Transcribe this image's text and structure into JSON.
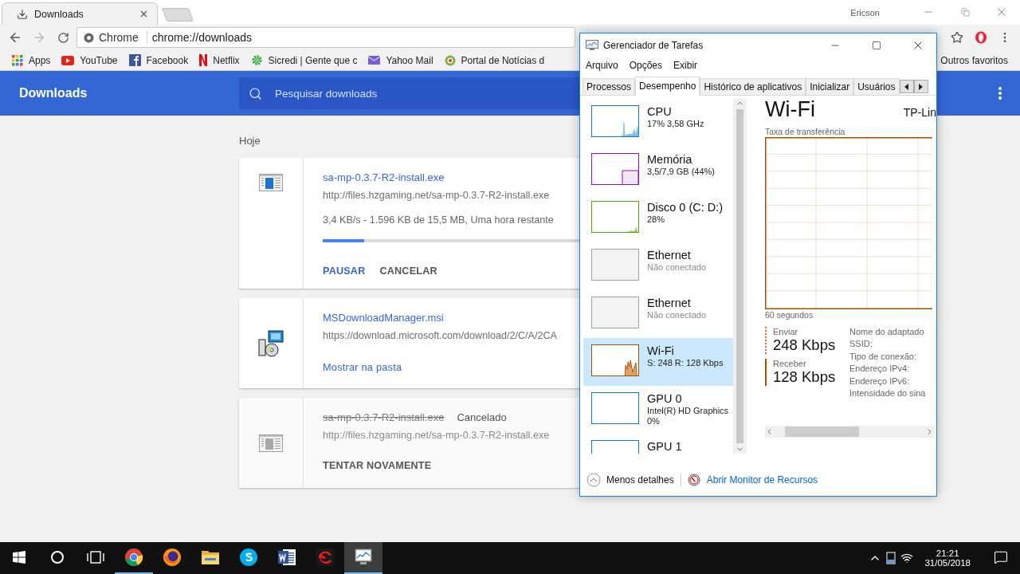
{
  "chrome": {
    "tab": {
      "title": "Downloads"
    },
    "user": "Ericson",
    "omnibox": {
      "chip": "Chrome",
      "url": "chrome://downloads"
    },
    "bookmarks": [
      {
        "kind": "apps",
        "label": "Apps"
      },
      {
        "kind": "youtube",
        "label": "YouTube"
      },
      {
        "kind": "facebook",
        "label": "Facebook"
      },
      {
        "kind": "netflix",
        "label": "Netflix"
      },
      {
        "kind": "sicredi",
        "label": "Sicredi | Gente que c"
      },
      {
        "kind": "mail",
        "label": "Yahoo Mail"
      },
      {
        "kind": "portal",
        "label": "Portal de Notícias d"
      }
    ],
    "other_bookmarks": "Outros favoritos"
  },
  "downloads_page": {
    "title": "Downloads",
    "search": {
      "placeholder": "Pesquisar downloads"
    },
    "section": "Hoje",
    "items": [
      {
        "kind": "in_progress",
        "name": "sa-mp-0.3.7-R2-install.exe",
        "url": "http://files.hzgaming.net/sa-mp-0.3.7-R2-install.exe",
        "status": "3,4 KB/s - 1.596 KB de 15,5 MB, Uma hora restante",
        "level": 0.16,
        "actions": [
          {
            "label": "PAUSAR",
            "primary": true
          },
          {
            "label": "CANCELAR",
            "primary": false
          }
        ]
      },
      {
        "kind": "complete",
        "name": "MSDownloadManager.msi",
        "url": "https://download.microsoft.com/download/2/C/A/2CA",
        "actions": [
          {
            "label": "Mostrar na pasta",
            "primary": true
          }
        ]
      },
      {
        "kind": "cancelled",
        "name": "sa-mp-0.3.7-R2-install.exe",
        "status": "Cancelado",
        "url": "http://files.hzgaming.net/sa-mp-0.3.7-R2-install.exe",
        "actions": [
          {
            "label": "TENTAR NOVAMENTE",
            "primary": false
          }
        ]
      }
    ]
  },
  "task_manager": {
    "title": "Gerenciador de Tarefas",
    "menu": [
      "Arquivo",
      "Opções",
      "Exibir"
    ],
    "tabs": [
      {
        "label": "Processos",
        "selected": false
      },
      {
        "label": "Desempenho",
        "selected": true
      },
      {
        "label": "Histórico de aplicativos",
        "selected": false
      },
      {
        "label": "Inicializar",
        "selected": false
      },
      {
        "label": "Usuários",
        "selected": false
      }
    ],
    "resources": [
      {
        "kind": "cpu",
        "name": "CPU",
        "details": [
          "17% 3,58 GHz"
        ],
        "color": "#117dbb",
        "connected": true,
        "selected": false
      },
      {
        "kind": "memory",
        "name": "Memória",
        "details": [
          "3,5/7,9 GB (44%)"
        ],
        "color": "#8b12ae",
        "connected": true,
        "selected": false
      },
      {
        "kind": "disk",
        "name": "Disco 0 (C: D:)",
        "details": [
          "28%"
        ],
        "color": "#4da60c",
        "connected": true,
        "selected": false
      },
      {
        "kind": "network",
        "name": "Ethernet",
        "details": [
          "Não conectado"
        ],
        "color": "#a0a0a0",
        "connected": false,
        "selected": false
      },
      {
        "kind": "network",
        "name": "Ethernet",
        "details": [
          "Não conectado"
        ],
        "color": "#a0a0a0",
        "connected": false,
        "selected": false
      },
      {
        "kind": "wifi",
        "name": "Wi-Fi",
        "details": [
          "S: 248 R: 128 Kbps"
        ],
        "color": "#a74f01",
        "connected": true,
        "selected": true
      },
      {
        "kind": "gpu",
        "name": "GPU 0",
        "details": [
          "Intel(R) HD Graphics",
          "0%"
        ],
        "color": "#117dbb",
        "connected": true,
        "selected": false
      },
      {
        "kind": "gpu",
        "name": "GPU 1",
        "color": "#117dbb",
        "connected": true,
        "selected": false
      }
    ],
    "detail": {
      "title": "Wi-Fi",
      "adapter": "TP-Lin",
      "graph_label": "Taxa de transferência",
      "graph_axis": "60 segundos",
      "stats": [
        {
          "kind": "send",
          "label": "Enviar",
          "value": "248 Kbps"
        },
        {
          "kind": "receive",
          "label": "Receber",
          "value": "128 Kbps"
        }
      ],
      "properties": [
        "Nome do adaptado",
        "SSID:",
        "Tipo de conexão:",
        "Endereço IPv4:",
        "Endereço IPv6:",
        "Intensidade do sina"
      ]
    },
    "footer": {
      "less_details": "Menos detalhes",
      "resource_monitor": "Abrir Monitor de Recursos"
    }
  },
  "taskbar": {
    "apps": [
      {
        "kind": "chrome",
        "running": true,
        "selected": false
      },
      {
        "kind": "firefox",
        "running": false,
        "selected": false
      },
      {
        "kind": "explorer",
        "running": false,
        "selected": false
      },
      {
        "kind": "skype",
        "running": false,
        "selected": false
      },
      {
        "kind": "word",
        "running": false,
        "selected": false
      },
      {
        "kind": "garena",
        "running": false,
        "selected": false
      },
      {
        "kind": "taskmgr",
        "running": true,
        "selected": true
      }
    ],
    "time": "21:21",
    "date": "31/05/2018"
  }
}
